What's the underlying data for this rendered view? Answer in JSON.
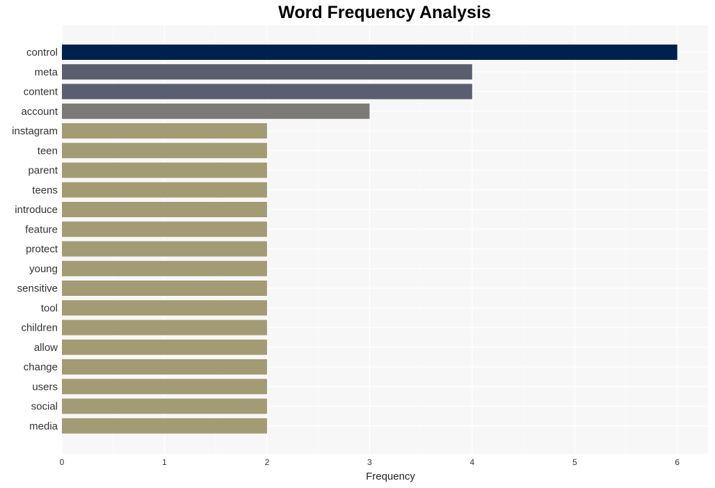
{
  "chart_data": {
    "type": "bar",
    "orientation": "horizontal",
    "title": "Word Frequency Analysis",
    "xlabel": "Frequency",
    "ylabel": "",
    "xlim": [
      0,
      6.3
    ],
    "xticks": [
      0,
      1,
      2,
      3,
      4,
      5,
      6
    ],
    "grid": true,
    "categories": [
      "control",
      "meta",
      "content",
      "account",
      "instagram",
      "teen",
      "parent",
      "teens",
      "introduce",
      "feature",
      "protect",
      "young",
      "sensitive",
      "tool",
      "children",
      "allow",
      "change",
      "users",
      "social",
      "media"
    ],
    "values": [
      6,
      4,
      4,
      3,
      2,
      2,
      2,
      2,
      2,
      2,
      2,
      2,
      2,
      2,
      2,
      2,
      2,
      2,
      2,
      2
    ],
    "colors": [
      "#00214d",
      "#5b5e6e",
      "#5b5e6e",
      "#7b7a76",
      "#a39b74",
      "#a39b74",
      "#a39b74",
      "#a39b74",
      "#a39b74",
      "#a39b74",
      "#a39b74",
      "#a39b74",
      "#a39b74",
      "#a39b74",
      "#a39b74",
      "#a39b74",
      "#a39b74",
      "#a39b74",
      "#a39b74",
      "#a39b74"
    ]
  }
}
